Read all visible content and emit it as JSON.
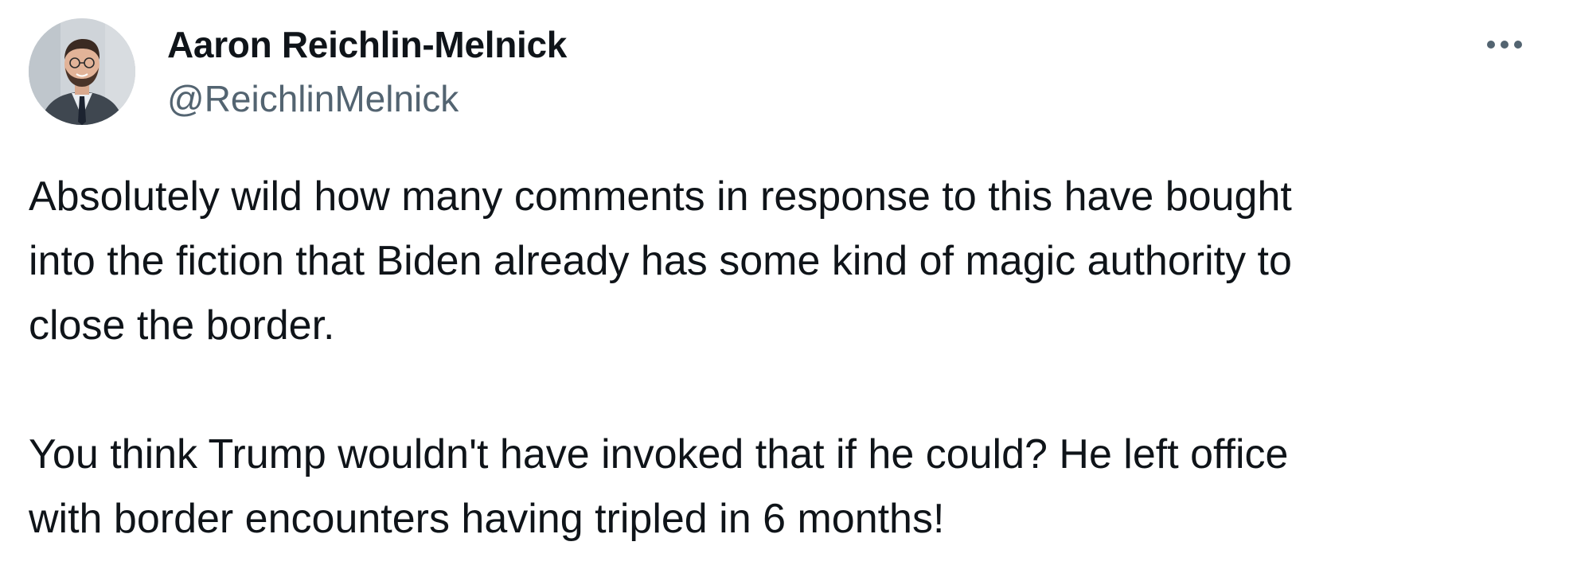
{
  "author": {
    "display_name": "Aaron Reichlin-Melnick",
    "handle": "@ReichlinMelnick"
  },
  "tweet": {
    "paragraph_1": [
      "Absolutely wild how many comments in response to this have bought",
      "into the fiction that Biden already has some kind of magic authority to",
      "close the border."
    ],
    "paragraph_2": [
      "You think Trump wouldn't have invoked that if he could? He left office",
      "with border encounters having tripled in 6 months!"
    ]
  },
  "icons": {
    "more": "more-horizontal-icon"
  },
  "colors": {
    "text_primary": "#0f1419",
    "text_secondary": "#536471"
  }
}
